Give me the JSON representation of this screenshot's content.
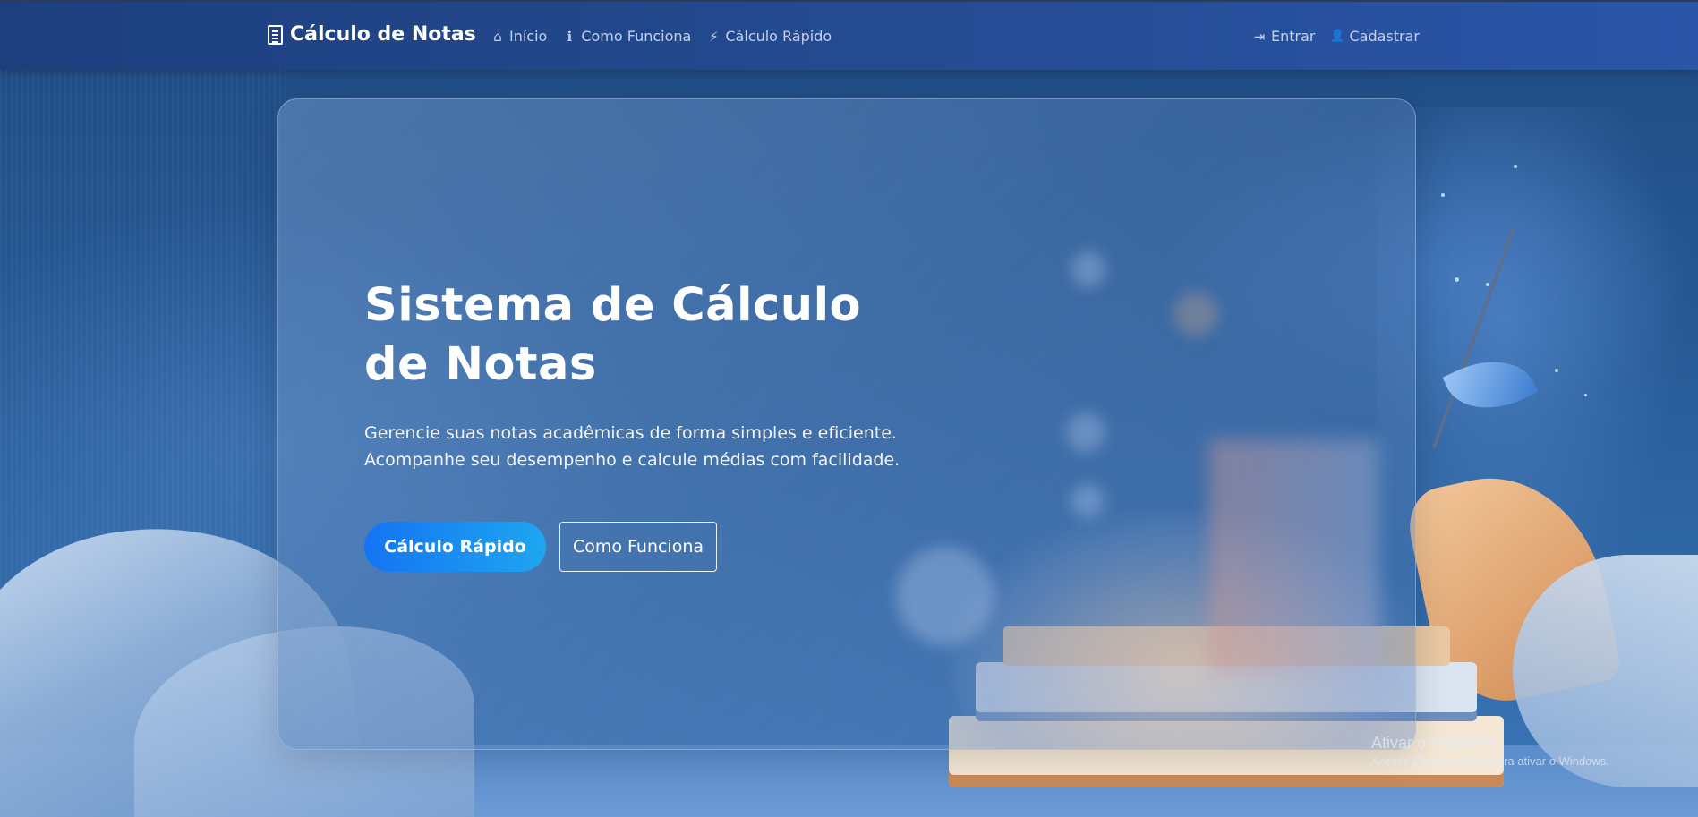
{
  "navbar": {
    "brand": {
      "icon": "document-icon",
      "label": "Cálculo de Notas"
    },
    "links_left": [
      {
        "icon": "home-icon",
        "glyph": "⌂",
        "label": "Início"
      },
      {
        "icon": "info-circle-icon",
        "glyph": "ℹ",
        "label": "Como Funciona"
      },
      {
        "icon": "bolt-icon",
        "glyph": "⚡",
        "label": "Cálculo Rápido"
      }
    ],
    "links_right": [
      {
        "icon": "sign-in-icon",
        "glyph": "⇥",
        "label": "Entrar"
      },
      {
        "icon": "user-plus-icon",
        "glyph": "👤",
        "label": "Cadastrar"
      }
    ]
  },
  "hero": {
    "title": "Sistema de Cálculo de Notas",
    "description": "Gerencie suas notas acadêmicas de forma simples e eficiente. Acompanhe seu desempenho e calcule médias com facilidade.",
    "primary_button": "Cálculo Rápido",
    "secondary_button": "Como Funciona"
  },
  "watermark": {
    "title": "Ativar o Windows",
    "subtitle": "Acesse Configurações para ativar o Windows."
  },
  "colors": {
    "navbar": "#244a90",
    "primary_button_start": "#1474f3",
    "primary_button_end": "#1ea6f0",
    "text_light": "#ffffff",
    "nav_link": "#c3d0e6"
  }
}
